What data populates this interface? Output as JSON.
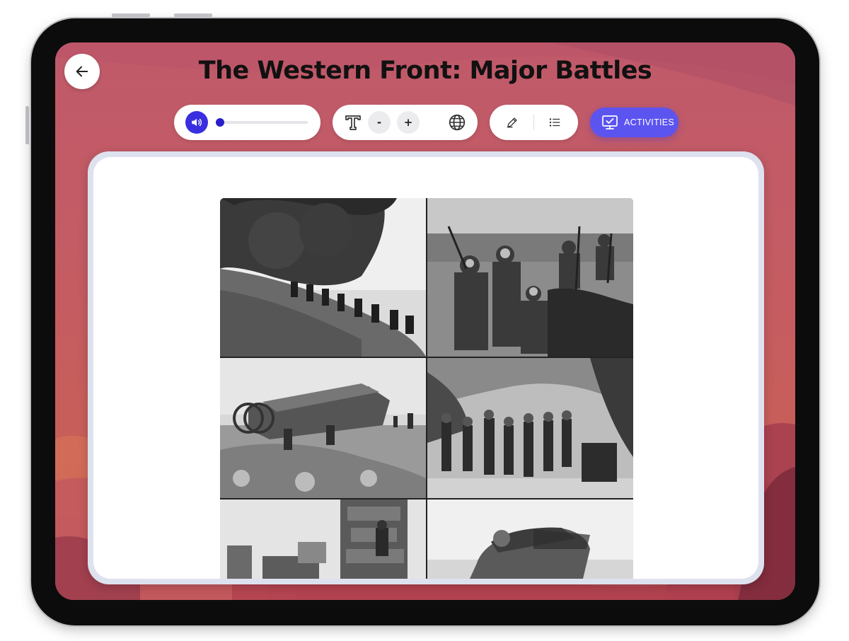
{
  "lesson": {
    "title": "The Western Front: Major Battles"
  },
  "toolbar": {
    "audio_progress": 0.02,
    "activities_label": "ACTIVITIES",
    "decrease_label": "-",
    "increase_label": "+"
  },
  "icons": {
    "back": "arrow-left-icon",
    "audio": "speaker-icon",
    "text_size": "text-t-icon",
    "language": "globe-icon",
    "annotate": "pencil-icon",
    "contents": "list-icon",
    "activities": "monitor-check-icon"
  },
  "colors": {
    "accent": "#5b54ef",
    "audio_button": "#3a2fe0",
    "background": "#c45c62"
  },
  "collage": {
    "images": [
      "soldiers-climbing-hillside-photo",
      "soldiers-in-trench-photo",
      "tank-on-rubble-photo",
      "troops-marching-road-photo",
      "soldier-in-ruins-photo",
      "wrecked-tank-photo"
    ]
  }
}
